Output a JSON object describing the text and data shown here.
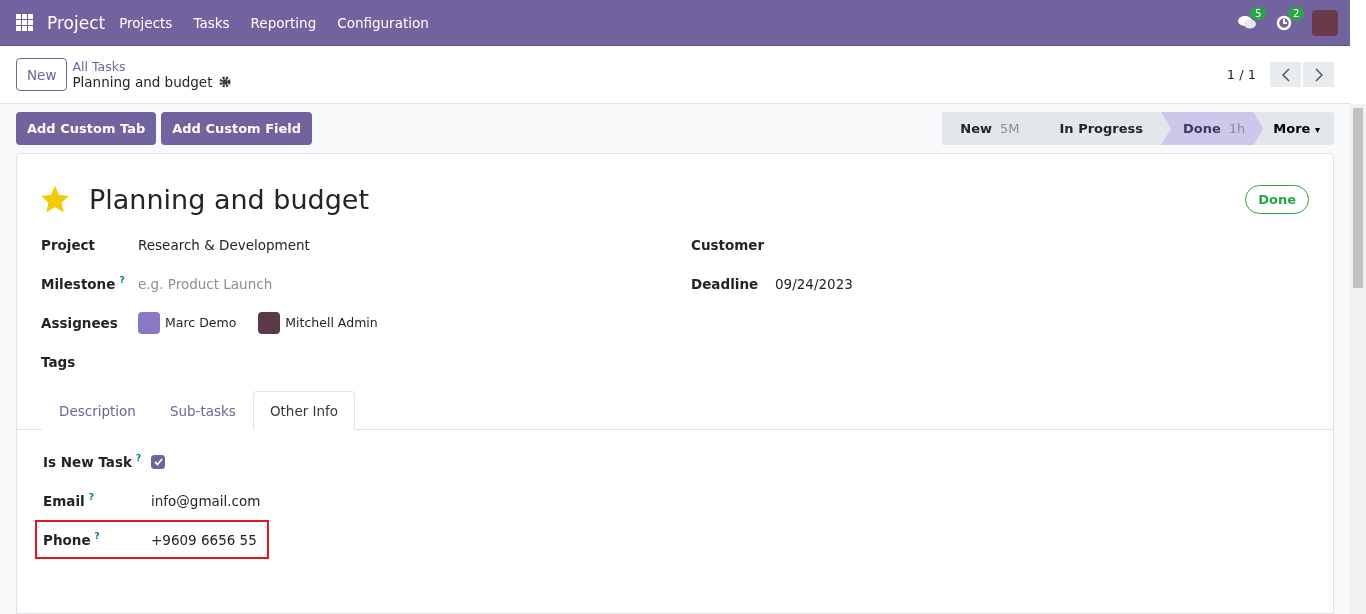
{
  "navbar": {
    "app_name": "Project",
    "menu": [
      "Projects",
      "Tasks",
      "Reporting",
      "Configuration"
    ],
    "messages_count": "5",
    "activities_count": "2"
  },
  "control_panel": {
    "new_button": "New",
    "breadcrumb": "All Tasks",
    "record_title": "Planning and budget",
    "pager": "1 / 1"
  },
  "actions": [
    "Add Custom Tab",
    "Add Custom Field"
  ],
  "stages": [
    {
      "label": "New",
      "duration": "5M",
      "selected": false
    },
    {
      "label": "In Progress",
      "selected": false
    },
    {
      "label": "Done",
      "duration": "1h",
      "selected": true
    }
  ],
  "more_button": "More",
  "more_caret": "▾",
  "task": {
    "starred": true,
    "title": "Planning and budget",
    "status": "Done",
    "left_fields": [
      {
        "label": "Project",
        "value": "Research & Development"
      },
      {
        "label": "Milestone",
        "help": "?",
        "placeholder": "e.g. Product Launch"
      },
      {
        "label": "Assignees",
        "people": [
          "Marc Demo",
          "Mitchell Admin"
        ]
      },
      {
        "label": "Tags"
      }
    ],
    "right_fields": [
      {
        "label": "Customer"
      },
      {
        "label": "Deadline",
        "value": "09/24/2023"
      }
    ]
  },
  "tabs": [
    {
      "label": "Description",
      "selected": false
    },
    {
      "label": "Sub-tasks",
      "selected": false
    },
    {
      "label": "Other Info",
      "selected": true
    }
  ],
  "other_info": [
    {
      "kind": "checkbox",
      "label": "Is New Task",
      "help": "?",
      "checked": true,
      "highlighted": false
    },
    {
      "kind": "text",
      "label": "Email",
      "help": "?",
      "value": "info@gmail.com",
      "highlighted": false
    },
    {
      "kind": "text",
      "label": "Phone",
      "help": "?",
      "value": "+9609 6656 55",
      "highlighted": true
    }
  ]
}
